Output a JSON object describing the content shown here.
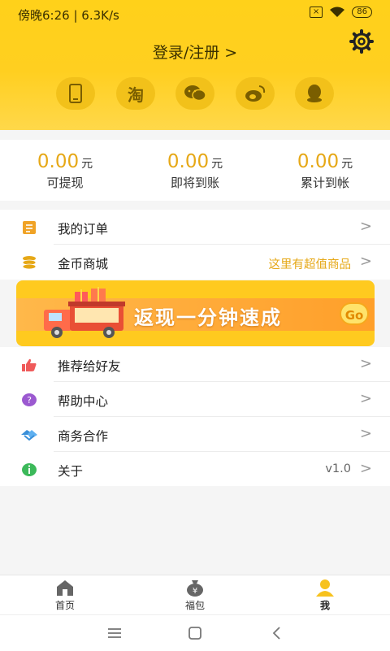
{
  "status_bar": {
    "time": "傍晚6:26 | 6.3K/s",
    "battery": "86"
  },
  "header": {
    "login_text": "登录/注册 >"
  },
  "login_options": [
    {
      "icon": "phone-icon"
    },
    {
      "icon": "taobao-icon",
      "label": "淘"
    },
    {
      "icon": "wechat-icon"
    },
    {
      "icon": "weibo-icon"
    },
    {
      "icon": "qq-icon"
    }
  ],
  "earnings": [
    {
      "amount": "0.00",
      "unit": "元",
      "label": "可提现"
    },
    {
      "amount": "0.00",
      "unit": "元",
      "label": "即将到账"
    },
    {
      "amount": "0.00",
      "unit": "元",
      "label": "累计到帐"
    }
  ],
  "menu": {
    "orders": {
      "label": "我的订单"
    },
    "coin_mall": {
      "label": "金币商城",
      "extra": "这里有超值商品"
    },
    "recommend": {
      "label": "推荐给好友"
    },
    "help": {
      "label": "帮助中心"
    },
    "business": {
      "label": "商务合作"
    },
    "about": {
      "label": "关于",
      "extra": "v1.0"
    }
  },
  "banner": {
    "text": "返现一分钟速成",
    "button": "Go"
  },
  "bottom_nav": [
    {
      "label": "首页",
      "icon": "home-icon"
    },
    {
      "label": "福包",
      "icon": "money-bag-icon"
    },
    {
      "label": "我",
      "icon": "user-icon"
    }
  ],
  "colors": {
    "primary": "#ffd11a",
    "accent": "#e6a817"
  }
}
